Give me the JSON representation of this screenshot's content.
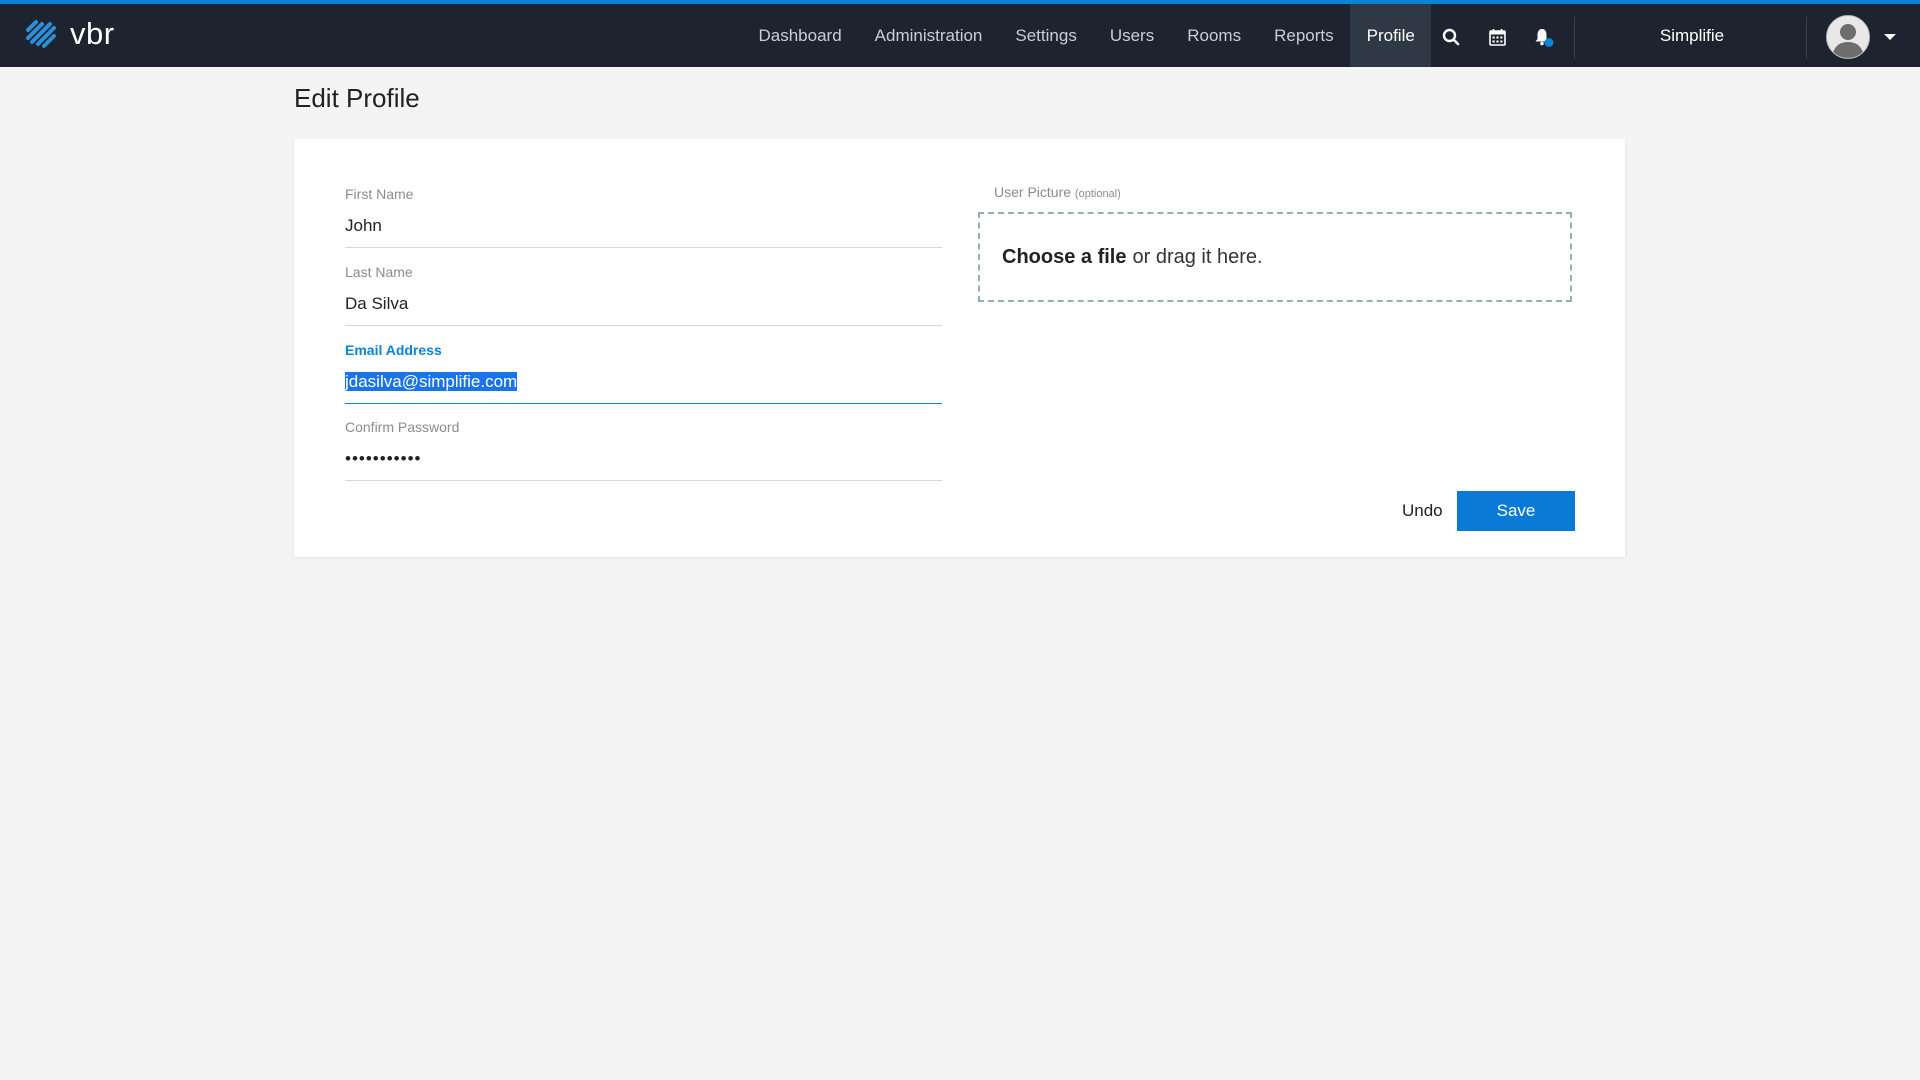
{
  "app": {
    "logo_text": "vbr"
  },
  "nav": {
    "items": [
      {
        "label": "Dashboard"
      },
      {
        "label": "Administration"
      },
      {
        "label": "Settings"
      },
      {
        "label": "Users"
      },
      {
        "label": "Rooms"
      },
      {
        "label": "Reports"
      },
      {
        "label": "Profile"
      }
    ],
    "active": "Profile",
    "icons": [
      "search-icon",
      "calendar-icon",
      "bell-icon"
    ],
    "org_name": "Simplifie",
    "accent_color": "#0a83d8"
  },
  "page": {
    "title": "Edit Profile"
  },
  "form": {
    "first_name": {
      "label": "First Name",
      "value": "John"
    },
    "last_name": {
      "label": "Last Name",
      "value": "Da Silva"
    },
    "email": {
      "label": "Email Address",
      "value": "jdasilva@simplifie.com"
    },
    "confirm_password": {
      "label": "Confirm Password",
      "value": "•••••••••••"
    },
    "picture": {
      "label": "User Picture",
      "label_note": "(optional)",
      "dropzone_bold": "Choose a file",
      "dropzone_rest": "or drag it here."
    },
    "undo_label": "Undo",
    "save_label": "Save"
  }
}
